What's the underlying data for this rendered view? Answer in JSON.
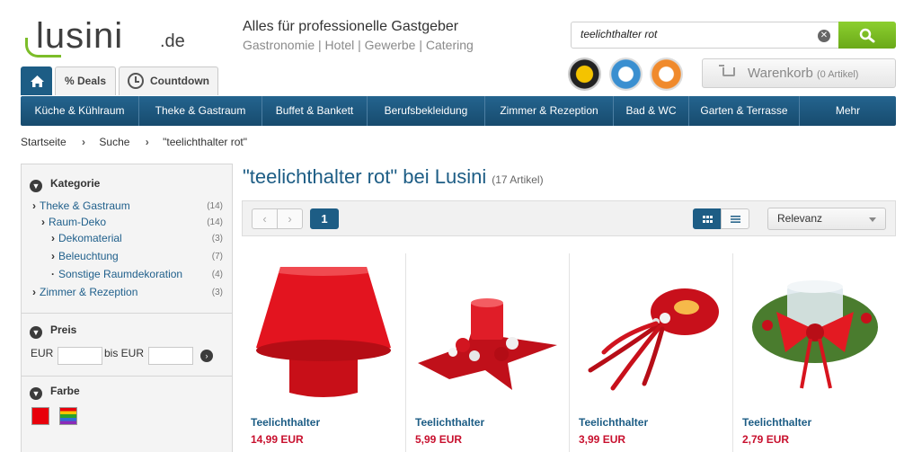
{
  "header": {
    "logo_text": "lusini",
    "logo_tld": ".de",
    "tagline_title": "Alles für professionelle Gastgeber",
    "tagline_sub": "Gastronomie | Hotel | Gewerbe | Catering"
  },
  "search": {
    "value": "teelichthalter rot",
    "clear_icon": "close-icon",
    "button_icon": "search-icon"
  },
  "tabs": {
    "home_icon": "home-icon",
    "deals_label": "% Deals",
    "countdown_label": "Countdown"
  },
  "cart": {
    "label": "Warenkorb",
    "count_label": "(0 Artikel)"
  },
  "nav": {
    "items": [
      "Küche & Kühlraum",
      "Theke & Gastraum",
      "Buffet & Bankett",
      "Berufsbekleidung",
      "Zimmer & Rezeption",
      "Bad & WC",
      "Garten & Terrasse",
      "Mehr"
    ]
  },
  "breadcrumb": {
    "items": [
      "Startseite",
      "Suche",
      "\"teelichthalter rot\""
    ]
  },
  "sidebar": {
    "category_heading": "Kategorie",
    "categories": [
      {
        "label": "Theke & Gastraum",
        "count": "(14)"
      },
      {
        "label": "Raum-Deko",
        "count": "(14)"
      },
      {
        "label": "Dekomaterial",
        "count": "(3)"
      },
      {
        "label": "Beleuchtung",
        "count": "(7)"
      },
      {
        "label": "Sonstige Raumdekoration",
        "count": "(4)"
      },
      {
        "label": "Zimmer & Rezeption",
        "count": "(3)"
      }
    ],
    "price_heading": "Preis",
    "price_from_label": "EUR",
    "price_to_label": "bis EUR",
    "color_heading": "Farbe",
    "colors": [
      "#e8000b",
      "multicolor"
    ]
  },
  "main": {
    "title": "\"teelichthalter rot\" bei Lusini",
    "count_label": "(17 Artikel)",
    "page": "1",
    "sort_label": "Relevanz"
  },
  "products": [
    {
      "name": "Teelichthalter",
      "price": "14,99 EUR"
    },
    {
      "name": "Teelichthalter",
      "price": "5,99 EUR"
    },
    {
      "name": "Teelichthalter",
      "price": "3,99 EUR"
    },
    {
      "name": "Teelichthalter",
      "price": "2,79 EUR"
    }
  ],
  "colors": {
    "brand_blue": "#1d5d85",
    "accent_green": "#7cbd29",
    "price_red": "#c8102e"
  }
}
